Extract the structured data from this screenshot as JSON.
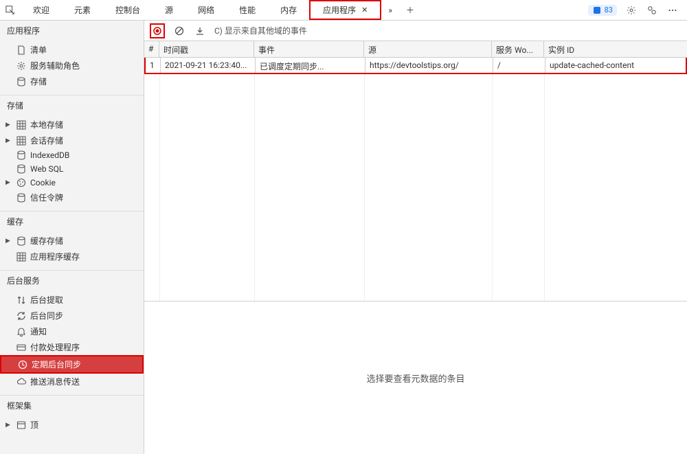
{
  "tabs": {
    "items": [
      "欢迎",
      "元素",
      "控制台",
      "源",
      "网络",
      "性能",
      "内存",
      "应用程序"
    ],
    "active_index": 7
  },
  "toolbar_right": {
    "issues_count": "83"
  },
  "sidebar": {
    "sections": [
      {
        "title": "应用程序",
        "items": [
          {
            "icon": "manifest",
            "label": "清单",
            "expand": false
          },
          {
            "icon": "service",
            "label": "服务辅助角色",
            "expand": false
          },
          {
            "icon": "db",
            "label": "存储",
            "expand": false
          }
        ]
      },
      {
        "title": "存储",
        "items": [
          {
            "icon": "grid",
            "label": "本地存储",
            "expand": true
          },
          {
            "icon": "grid",
            "label": "会话存储",
            "expand": true
          },
          {
            "icon": "db",
            "label": "IndexedDB",
            "expand": false
          },
          {
            "icon": "db",
            "label": "Web SQL",
            "expand": false
          },
          {
            "icon": "cookie",
            "label": "Cookie",
            "expand": true
          },
          {
            "icon": "db",
            "label": "信任令牌",
            "expand": false
          }
        ]
      },
      {
        "title": "缓存",
        "items": [
          {
            "icon": "db",
            "label": "缓存存储",
            "expand": true
          },
          {
            "icon": "grid",
            "label": "应用程序缓存",
            "expand": false
          }
        ]
      },
      {
        "title": "后台服务",
        "items": [
          {
            "icon": "fetch",
            "label": "后台提取",
            "expand": false
          },
          {
            "icon": "sync",
            "label": "后台同步",
            "expand": false
          },
          {
            "icon": "bell",
            "label": "通知",
            "expand": false
          },
          {
            "icon": "card",
            "label": "付款处理程序",
            "expand": false
          },
          {
            "icon": "clock",
            "label": "定期后台同步",
            "expand": false,
            "selected": true
          },
          {
            "icon": "cloud",
            "label": "推送消息传送",
            "expand": false
          }
        ]
      },
      {
        "title": "框架集",
        "items": [
          {
            "icon": "window",
            "label": "顶",
            "expand": true
          }
        ]
      }
    ]
  },
  "main_toolbar": {
    "show_other_domains": "C) 显示来自其他域的事件"
  },
  "table": {
    "headers": {
      "idx": "#",
      "timestamp": "时间戳",
      "event": "事件",
      "source": "源",
      "service": "服务 Wo...",
      "instance": "实例 ID"
    },
    "rows": [
      {
        "idx": "1",
        "timestamp": "2021-09-21 16:23:40...",
        "event": "已调度定期同步...",
        "source": "https://devtoolstips.org/",
        "service": "/",
        "instance": "update-cached-content"
      }
    ]
  },
  "detail_empty": "选择要查看元数据的条目"
}
